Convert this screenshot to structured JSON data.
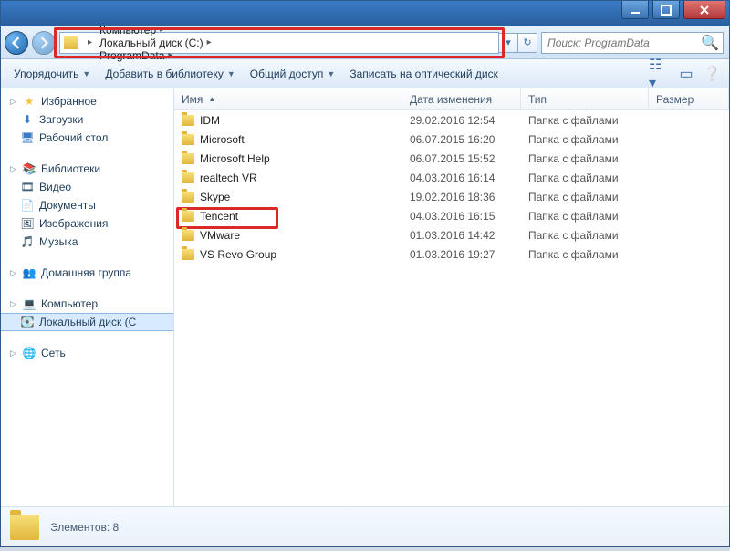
{
  "breadcrumbs": [
    "Компьютер",
    "Локальный диск (C:)",
    "ProgramData"
  ],
  "search_placeholder": "Поиск: ProgramData",
  "toolbar": {
    "organize": "Упорядочить",
    "add_to_library": "Добавить в библиотеку",
    "share": "Общий доступ",
    "burn": "Записать на оптический диск"
  },
  "sidebar": {
    "favorites": {
      "label": "Избранное",
      "items": [
        "Загрузки",
        "Рабочий стол"
      ]
    },
    "libraries": {
      "label": "Библиотеки",
      "items": [
        "Видео",
        "Документы",
        "Изображения",
        "Музыка"
      ]
    },
    "homegroup": {
      "label": "Домашняя группа"
    },
    "computer": {
      "label": "Компьютер",
      "items": [
        "Локальный диск (C"
      ]
    },
    "network": {
      "label": "Сеть"
    }
  },
  "columns": {
    "name": "Имя",
    "date": "Дата изменения",
    "type": "Тип",
    "size": "Размер"
  },
  "files": [
    {
      "name": "IDM",
      "date": "29.02.2016 12:54",
      "type": "Папка с файлами",
      "highlight": false
    },
    {
      "name": "Microsoft",
      "date": "06.07.2015 16:20",
      "type": "Папка с файлами",
      "highlight": false
    },
    {
      "name": "Microsoft Help",
      "date": "06.07.2015 15:52",
      "type": "Папка с файлами",
      "highlight": false
    },
    {
      "name": "realtech VR",
      "date": "04.03.2016 16:14",
      "type": "Папка с файлами",
      "highlight": false
    },
    {
      "name": "Skype",
      "date": "19.02.2016 18:36",
      "type": "Папка с файлами",
      "highlight": false
    },
    {
      "name": "Tencent",
      "date": "04.03.2016 16:15",
      "type": "Папка с файлами",
      "highlight": true
    },
    {
      "name": "VMware",
      "date": "01.03.2016 14:42",
      "type": "Папка с файлами",
      "highlight": false
    },
    {
      "name": "VS Revo Group",
      "date": "01.03.2016 19:27",
      "type": "Папка с файлами",
      "highlight": false
    }
  ],
  "status": {
    "count_label": "Элементов: 8"
  }
}
